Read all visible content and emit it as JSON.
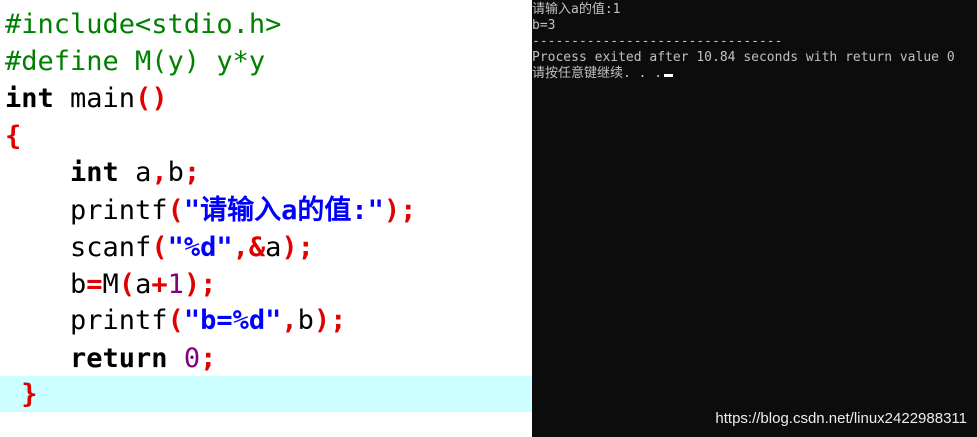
{
  "editor": {
    "lines": [
      [
        {
          "t": "#include<stdio.h>",
          "c": "pp"
        }
      ],
      [
        {
          "t": "#define M(y) y*y",
          "c": "pp"
        }
      ],
      [
        {
          "t": "int",
          "c": "kw"
        },
        {
          "t": " main",
          "c": "plain"
        },
        {
          "t": "()",
          "c": "pn"
        }
      ],
      [
        {
          "t": "{",
          "c": "pn"
        }
      ],
      [
        {
          "t": "    ",
          "c": "plain"
        },
        {
          "t": "int",
          "c": "kw"
        },
        {
          "t": " a",
          "c": "plain"
        },
        {
          "t": ",",
          "c": "pn"
        },
        {
          "t": "b",
          "c": "plain"
        },
        {
          "t": ";",
          "c": "pn"
        }
      ],
      [
        {
          "t": "    printf",
          "c": "plain"
        },
        {
          "t": "(",
          "c": "pn"
        },
        {
          "t": "\"请输入a的值:\"",
          "c": "str"
        },
        {
          "t": ");",
          "c": "pn"
        }
      ],
      [
        {
          "t": "    scanf",
          "c": "plain"
        },
        {
          "t": "(",
          "c": "pn"
        },
        {
          "t": "\"%d\"",
          "c": "str"
        },
        {
          "t": ",&",
          "c": "pn"
        },
        {
          "t": "a",
          "c": "plain"
        },
        {
          "t": ");",
          "c": "pn"
        }
      ],
      [
        {
          "t": "    b",
          "c": "plain"
        },
        {
          "t": "=",
          "c": "pn"
        },
        {
          "t": "M",
          "c": "plain"
        },
        {
          "t": "(",
          "c": "pn"
        },
        {
          "t": "a",
          "c": "plain"
        },
        {
          "t": "+",
          "c": "pn"
        },
        {
          "t": "1",
          "c": "num"
        },
        {
          "t": ");",
          "c": "pn"
        }
      ],
      [
        {
          "t": "    printf",
          "c": "plain"
        },
        {
          "t": "(",
          "c": "pn"
        },
        {
          "t": "\"b=%d\"",
          "c": "str"
        },
        {
          "t": ",",
          "c": "pn"
        },
        {
          "t": "b",
          "c": "plain"
        },
        {
          "t": ");",
          "c": "pn"
        }
      ],
      [
        {
          "t": "    ",
          "c": "plain"
        },
        {
          "t": "return",
          "c": "kw"
        },
        {
          "t": " ",
          "c": "plain"
        },
        {
          "t": "0",
          "c": "num"
        },
        {
          "t": ";",
          "c": "pn"
        }
      ],
      [
        {
          "t": " ",
          "c": "plain"
        },
        {
          "t": "}",
          "c": "pn"
        }
      ]
    ]
  },
  "console": {
    "lines": [
      "请输入a的值:1",
      "b=3",
      "--------------------------------",
      "Process exited after 10.84 seconds with return value 0",
      "请按任意键继续. . ."
    ]
  },
  "watermark": "https://blog.csdn.net/linux2422988311"
}
